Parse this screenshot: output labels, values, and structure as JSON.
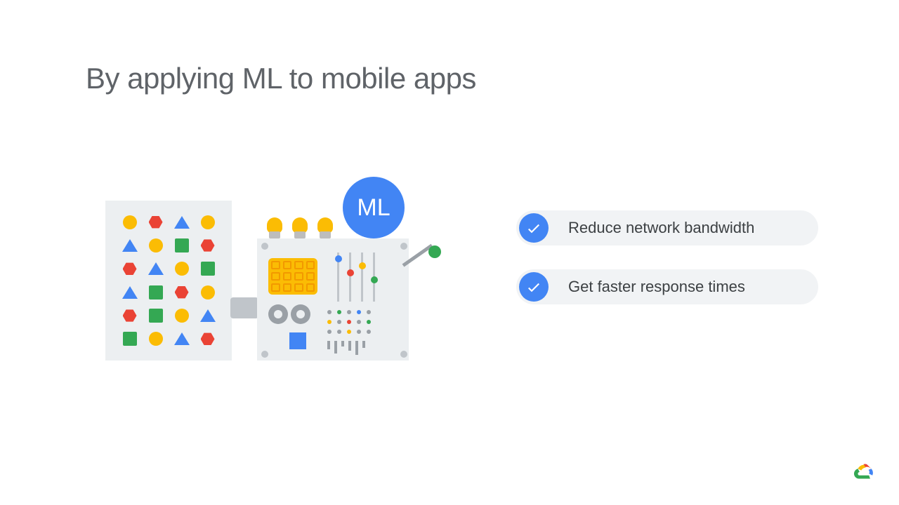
{
  "title": "By applying ML to mobile apps",
  "badge_label": "ML",
  "bullets": [
    {
      "text": "Reduce network bandwidth"
    },
    {
      "text": "Get faster response times"
    }
  ],
  "colors": {
    "blue": "#4285f4",
    "red": "#ea4335",
    "yellow": "#fbbc04",
    "green": "#34a853",
    "grey_text": "#5f6368",
    "pill_bg": "#f1f3f5"
  }
}
